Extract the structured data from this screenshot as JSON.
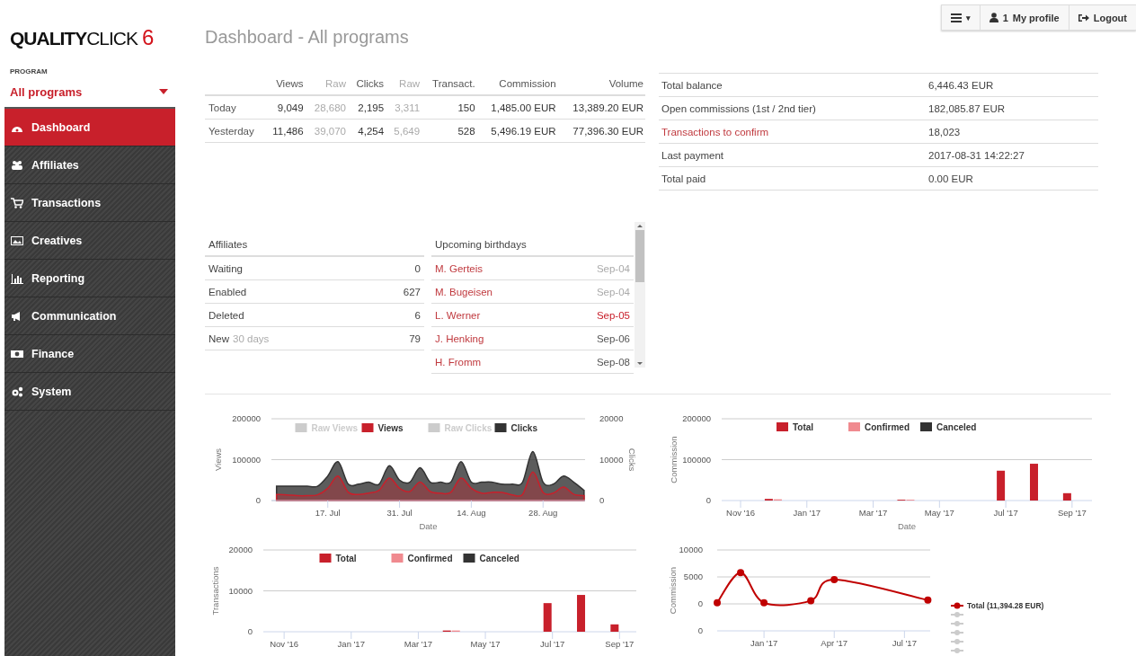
{
  "logo": {
    "bold": "QUALITY",
    "light": "CLICK",
    "number": "6"
  },
  "program": {
    "label": "PROGRAM",
    "value": "All programs"
  },
  "nav": [
    {
      "label": "Dashboard",
      "selected": true
    },
    {
      "label": "Affiliates",
      "selected": false
    },
    {
      "label": "Transactions",
      "selected": false
    },
    {
      "label": "Creatives",
      "selected": false
    },
    {
      "label": "Reporting",
      "selected": false
    },
    {
      "label": "Communication",
      "selected": false
    },
    {
      "label": "Finance",
      "selected": false
    },
    {
      "label": "System",
      "selected": false
    }
  ],
  "title": "Dashboard - All programs",
  "topbar": {
    "menu_caret": "▾",
    "badge": "1",
    "profile": "My profile",
    "logout": "Logout"
  },
  "stats": {
    "columns": [
      {
        "label": "Views",
        "muted": false
      },
      {
        "label": "Raw",
        "muted": true
      },
      {
        "label": "Clicks",
        "muted": false
      },
      {
        "label": "Raw",
        "muted": true
      },
      {
        "label": "Transact.",
        "muted": false
      },
      {
        "label": "Commission",
        "muted": false
      },
      {
        "label": "Volume",
        "muted": false
      }
    ],
    "rows": [
      {
        "label": "Today",
        "cells": [
          "9,049",
          "28,680",
          "2,195",
          "3,311",
          "150",
          "1,485.00 EUR",
          "13,389.20 EUR"
        ]
      },
      {
        "label": "Yesterday",
        "cells": [
          "11,486",
          "39,070",
          "4,254",
          "5,649",
          "528",
          "5,496.19 EUR",
          "77,396.30 EUR"
        ]
      }
    ]
  },
  "balance": [
    {
      "label": "Total balance",
      "value": "6,446.43 EUR",
      "kind": "text"
    },
    {
      "label": "Open commissions (1st / 2nd tier)",
      "value": "182,085.87 EUR",
      "kind": "text"
    },
    {
      "label": "Transactions to confirm",
      "value": "18,023",
      "kind": "link"
    },
    {
      "label": "Last payment",
      "value": "2017-08-31 14:22:27",
      "kind": "text"
    },
    {
      "label": "Total paid",
      "value": "0.00 EUR",
      "kind": "text"
    }
  ],
  "affiliates": {
    "title": "Affiliates",
    "rows": [
      {
        "label": "Waiting",
        "value": "0"
      },
      {
        "label": "Enabled",
        "value": "627"
      },
      {
        "label": "Deleted",
        "value": "6"
      },
      {
        "label": "New",
        "note": "30 days",
        "value": "79"
      }
    ]
  },
  "birthdays": {
    "title": "Upcoming birthdays",
    "rows": [
      {
        "name": "M. Gerteis",
        "date": "Sep-04",
        "color": "#aaaaaa"
      },
      {
        "name": "M. Bugeisen",
        "date": "Sep-04",
        "color": "#aaaaaa"
      },
      {
        "name": "L. Werner",
        "date": "Sep-05",
        "color": "#c8202b"
      },
      {
        "name": "J. Henking",
        "date": "Sep-06",
        "color": "#555555"
      },
      {
        "name": "H. Fromm",
        "date": "Sep-08",
        "color": "#555555"
      }
    ]
  },
  "traffic_chart": {
    "hidden_series": [
      {
        "name": "Raw Views",
        "color": "#cccccc"
      },
      {
        "name": "Raw Clicks",
        "color": "#cccccc"
      }
    ],
    "chart_data": {
      "type": "area",
      "legend": "top",
      "xlabel": "Date",
      "ylabel": "Views",
      "y2label": "Clicks",
      "categories": [
        null,
        null,
        null,
        null,
        null,
        "17. Jul",
        null,
        null,
        null,
        null,
        null,
        null,
        "31. Jul",
        null,
        null,
        null,
        null,
        null,
        null,
        "14. Aug",
        null,
        null,
        null,
        null,
        null,
        null,
        "28. Aug",
        null,
        null,
        null,
        null
      ],
      "ylim": [
        0,
        200000
      ],
      "yticks": [
        0,
        100000,
        200000
      ],
      "y2lim": [
        0,
        20000
      ],
      "y2ticks": [
        0,
        10000,
        20000
      ],
      "series": [
        {
          "name": "Views",
          "color": "#c8202b",
          "values": [
            15000,
            14000,
            12000,
            12000,
            14000,
            30000,
            60000,
            20000,
            15000,
            18000,
            25000,
            55000,
            30000,
            22000,
            45000,
            22000,
            18000,
            20000,
            55000,
            30000,
            18000,
            20000,
            20000,
            14000,
            15000,
            70000,
            20000,
            18000,
            33000,
            15000,
            12000
          ]
        },
        {
          "name": "Clicks",
          "color": "#333333",
          "axis": "y2",
          "values": [
            3500,
            3500,
            3500,
            3500,
            3500,
            6000,
            9500,
            4000,
            4000,
            4500,
            4000,
            8500,
            5000,
            4500,
            8000,
            4500,
            4500,
            4500,
            9500,
            4500,
            4500,
            4500,
            4000,
            4000,
            4500,
            12000,
            4500,
            4000,
            6000,
            4500,
            2500
          ]
        }
      ]
    }
  },
  "commission_chart": {
    "chart_data": {
      "type": "bar",
      "legend": "top",
      "xlabel": "Date",
      "ylabel": "Commission",
      "categories": [
        "Nov '16",
        null,
        "Jan '17",
        null,
        "Mar '17",
        null,
        "May '17",
        null,
        "Jul '17",
        null,
        "Sep '17"
      ],
      "ylim": [
        0,
        200000
      ],
      "yticks": [
        0,
        100000,
        200000
      ],
      "series": [
        {
          "name": "Total",
          "color": "#c8202b",
          "values": [
            0,
            4000,
            0,
            0,
            0,
            2000,
            0,
            0,
            73000,
            90000,
            18000
          ]
        },
        {
          "name": "Confirmed",
          "color": "#f08a8f",
          "values": [
            0,
            3000,
            0,
            0,
            0,
            2000,
            0,
            0,
            0,
            0,
            0
          ]
        },
        {
          "name": "Canceled",
          "color": "#333333",
          "values": [
            0,
            0,
            0,
            0,
            0,
            0,
            0,
            0,
            0,
            0,
            0
          ]
        }
      ]
    }
  },
  "transactions_chart": {
    "chart_data": {
      "type": "bar",
      "legend": "top",
      "ylabel": "Transactions",
      "categories": [
        "Nov '16",
        null,
        "Jan '17",
        null,
        "Mar '17",
        null,
        "May '17",
        null,
        "Jul '17",
        null,
        "Sep '17"
      ],
      "ylim": [
        0,
        20000
      ],
      "yticks": [
        0,
        10000,
        20000
      ],
      "series": [
        {
          "name": "Total",
          "color": "#c8202b",
          "values": [
            0,
            0,
            0,
            0,
            0,
            300,
            0,
            0,
            7000,
            9000,
            1800
          ]
        },
        {
          "name": "Confirmed",
          "color": "#f08a8f",
          "values": [
            0,
            0,
            0,
            0,
            0,
            300,
            0,
            0,
            0,
            0,
            0
          ]
        },
        {
          "name": "Canceled",
          "color": "#333333",
          "values": [
            0,
            0,
            0,
            0,
            0,
            0,
            0,
            0,
            0,
            0,
            0
          ]
        }
      ]
    }
  },
  "commission_line_chart": {
    "lower_axis_label": "0",
    "chart_data": {
      "type": "line",
      "legend": "right",
      "ylabel": "Commission",
      "categories": [
        null,
        null,
        "Jan '17",
        null,
        null,
        "Apr '17",
        null,
        null,
        "Jul '17",
        null
      ],
      "ylim": [
        0,
        10000
      ],
      "yticks": [
        0,
        5000,
        10000
      ],
      "series": [
        {
          "name": "Total (11,394.28 EUR)",
          "color": "#c00000",
          "marker": "circle",
          "values": [
            200,
            5800,
            200,
            null,
            600,
            4500,
            null,
            null,
            null,
            700
          ]
        }
      ]
    }
  }
}
